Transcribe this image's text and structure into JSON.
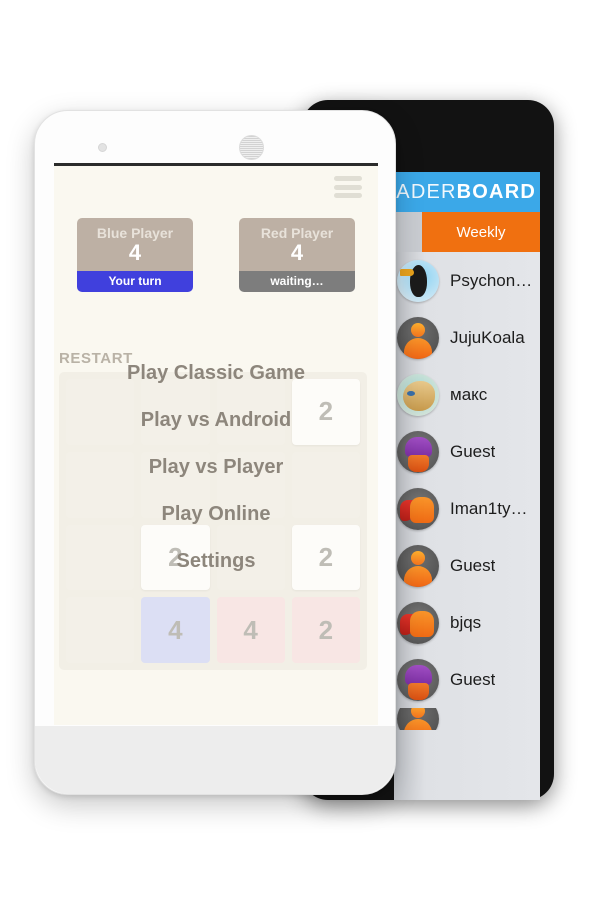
{
  "black_phone": {
    "leaderboard": {
      "title_light": "LEADER",
      "title_bold": "BOARD",
      "header_color": "#3ba8e8",
      "tabs": [
        {
          "label": "Weekly",
          "active": true,
          "color": "#f07010"
        }
      ],
      "entries": [
        {
          "name": "Psychon…",
          "avatar": "goose-avatar"
        },
        {
          "name": "JujuKoala",
          "avatar": "person-avatar"
        },
        {
          "name": "макс",
          "avatar": "lion-avatar"
        },
        {
          "name": "Guest",
          "avatar": "monster-avatar"
        },
        {
          "name": "Iman1ty…",
          "avatar": "runner-avatar"
        },
        {
          "name": "Guest",
          "avatar": "person-avatar"
        },
        {
          "name": "bjqs",
          "avatar": "runner-avatar"
        },
        {
          "name": "Guest",
          "avatar": "monster-avatar"
        }
      ]
    }
  },
  "white_phone": {
    "menu_icon": "hamburger-icon",
    "players": [
      {
        "name": "Blue Player",
        "score": "4",
        "status": "Your turn",
        "status_color": "#4040dd"
      },
      {
        "name": "Red Player",
        "score": "4",
        "status": "waiting…",
        "status_color": "#7d7d7d"
      }
    ],
    "restart_label": "RESTART",
    "menu_items": [
      "Play Classic Game",
      "Play vs Android",
      "Play vs Player",
      "Play Online",
      "Settings"
    ],
    "board": {
      "rows": [
        [
          "",
          "",
          "",
          "2"
        ],
        [
          "",
          "",
          "",
          ""
        ],
        [
          "",
          "2",
          "",
          "2"
        ],
        [
          "",
          "4",
          "4",
          "2"
        ]
      ],
      "tile_styles": [
        [
          "t-empty",
          "t-empty",
          "t-empty",
          "t-2"
        ],
        [
          "t-empty",
          "t-empty",
          "t-empty",
          "t-empty"
        ],
        [
          "t-empty",
          "t-2",
          "t-empty",
          "t-2"
        ],
        [
          "t-empty",
          "t-4b",
          "t-4",
          "t-2"
        ]
      ]
    }
  }
}
